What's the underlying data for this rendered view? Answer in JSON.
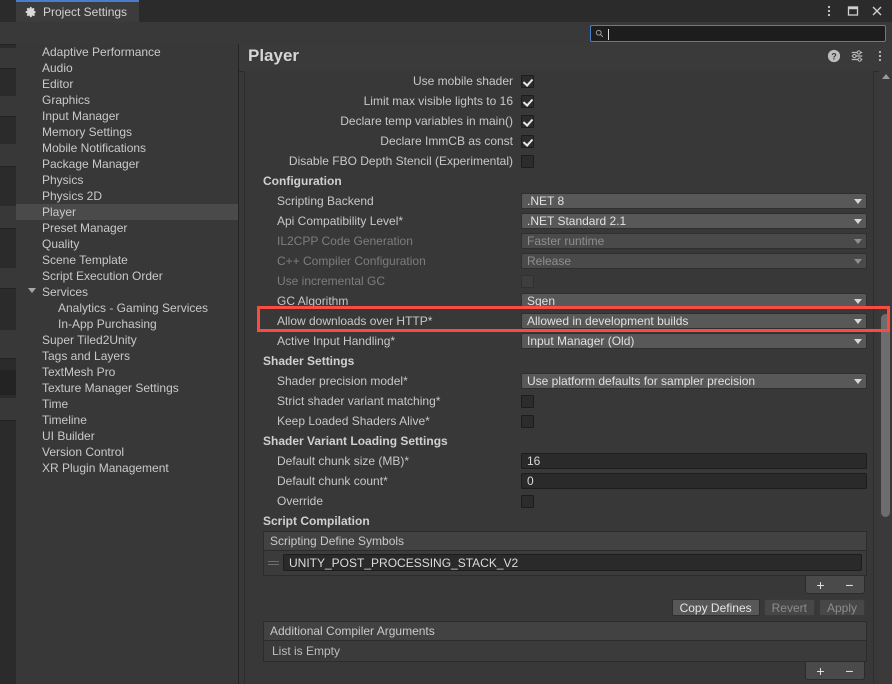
{
  "window": {
    "tab_label": "Project Settings",
    "tab_icon": "gear-icon",
    "controls": [
      {
        "name": "more-menu-icon",
        "glyph": "kebab"
      },
      {
        "name": "maximize-icon",
        "glyph": "square"
      },
      {
        "name": "close-icon",
        "glyph": "x"
      }
    ]
  },
  "search": {
    "value": "",
    "placeholder": "",
    "icon": "search-icon"
  },
  "sidebar": {
    "items": [
      {
        "label": "Adaptive Performance",
        "selected": false,
        "indent": false,
        "expandable": false
      },
      {
        "label": "Audio",
        "selected": false,
        "indent": false,
        "expandable": false
      },
      {
        "label": "Editor",
        "selected": false,
        "indent": false,
        "expandable": false
      },
      {
        "label": "Graphics",
        "selected": false,
        "indent": false,
        "expandable": false
      },
      {
        "label": "Input Manager",
        "selected": false,
        "indent": false,
        "expandable": false
      },
      {
        "label": "Memory Settings",
        "selected": false,
        "indent": false,
        "expandable": false
      },
      {
        "label": "Mobile Notifications",
        "selected": false,
        "indent": false,
        "expandable": false
      },
      {
        "label": "Package Manager",
        "selected": false,
        "indent": false,
        "expandable": false
      },
      {
        "label": "Physics",
        "selected": false,
        "indent": false,
        "expandable": false
      },
      {
        "label": "Physics 2D",
        "selected": false,
        "indent": false,
        "expandable": false
      },
      {
        "label": "Player",
        "selected": true,
        "indent": false,
        "expandable": false
      },
      {
        "label": "Preset Manager",
        "selected": false,
        "indent": false,
        "expandable": false
      },
      {
        "label": "Quality",
        "selected": false,
        "indent": false,
        "expandable": false
      },
      {
        "label": "Scene Template",
        "selected": false,
        "indent": false,
        "expandable": false
      },
      {
        "label": "Script Execution Order",
        "selected": false,
        "indent": false,
        "expandable": false
      },
      {
        "label": "Services",
        "selected": false,
        "indent": false,
        "expandable": true
      },
      {
        "label": "Analytics - Gaming Services",
        "selected": false,
        "indent": true,
        "expandable": false
      },
      {
        "label": "In-App Purchasing",
        "selected": false,
        "indent": true,
        "expandable": false
      },
      {
        "label": "Super Tiled2Unity",
        "selected": false,
        "indent": false,
        "expandable": false
      },
      {
        "label": "Tags and Layers",
        "selected": false,
        "indent": false,
        "expandable": false
      },
      {
        "label": "TextMesh Pro",
        "selected": false,
        "indent": false,
        "expandable": false
      },
      {
        "label": "Texture Manager Settings",
        "selected": false,
        "indent": false,
        "expandable": false
      },
      {
        "label": "Time",
        "selected": false,
        "indent": false,
        "expandable": false
      },
      {
        "label": "Timeline",
        "selected": false,
        "indent": false,
        "expandable": false
      },
      {
        "label": "UI Builder",
        "selected": false,
        "indent": false,
        "expandable": false
      },
      {
        "label": "Version Control",
        "selected": false,
        "indent": false,
        "expandable": false
      },
      {
        "label": "XR Plugin Management",
        "selected": false,
        "indent": false,
        "expandable": false
      }
    ]
  },
  "main": {
    "title": "Player",
    "header_icons": [
      {
        "name": "help-icon"
      },
      {
        "name": "preset-icon"
      },
      {
        "name": "context-menu-icon"
      }
    ],
    "top_checkboxes": [
      {
        "label": "Use mobile shader",
        "checked": true,
        "disabled": false
      },
      {
        "label": "Limit max visible lights to 16",
        "checked": true,
        "disabled": false
      },
      {
        "label": "Declare temp variables in main()",
        "checked": true,
        "disabled": false
      },
      {
        "label": "Declare ImmCB as const",
        "checked": true,
        "disabled": false
      },
      {
        "label": "Disable FBO Depth Stencil (Experimental)",
        "checked": false,
        "disabled": false
      }
    ],
    "configuration": {
      "heading": "Configuration",
      "rows": [
        {
          "label": "Scripting Backend",
          "type": "dropdown",
          "value": ".NET 8",
          "disabled": false,
          "highlighted": false
        },
        {
          "label": "Api Compatibility Level*",
          "type": "dropdown",
          "value": ".NET Standard 2.1",
          "disabled": false,
          "highlighted": false
        },
        {
          "label": "IL2CPP Code Generation",
          "type": "dropdown",
          "value": "Faster runtime",
          "disabled": true,
          "highlighted": false
        },
        {
          "label": "C++ Compiler Configuration",
          "type": "dropdown",
          "value": "Release",
          "disabled": true,
          "highlighted": false
        },
        {
          "label": "Use incremental GC",
          "type": "checkbox",
          "value": false,
          "disabled": true,
          "highlighted": false
        },
        {
          "label": "GC Algorithm",
          "type": "dropdown",
          "value": "Sgen",
          "disabled": false,
          "highlighted": false
        },
        {
          "label": "Allow downloads over HTTP*",
          "type": "dropdown",
          "value": "Allowed in development builds",
          "disabled": false,
          "highlighted": true
        },
        {
          "label": "Active Input Handling*",
          "type": "dropdown",
          "value": "Input Manager (Old)",
          "disabled": false,
          "highlighted": false
        }
      ]
    },
    "shader_settings": {
      "heading": "Shader Settings",
      "rows": [
        {
          "label": "Shader precision model*",
          "type": "dropdown",
          "value": "Use platform defaults for sampler precision",
          "disabled": false
        },
        {
          "label": "Strict shader variant matching*",
          "type": "checkbox",
          "value": false,
          "disabled": false
        },
        {
          "label": "Keep Loaded Shaders Alive*",
          "type": "checkbox",
          "value": false,
          "disabled": false
        }
      ]
    },
    "shader_variant_loading": {
      "heading": "Shader Variant Loading Settings",
      "rows": [
        {
          "label": "Default chunk size (MB)*",
          "type": "text",
          "value": "16",
          "disabled": false
        },
        {
          "label": "Default chunk count*",
          "type": "text",
          "value": "0",
          "disabled": false
        },
        {
          "label": "Override",
          "type": "checkbox",
          "value": false,
          "disabled": false
        }
      ]
    },
    "script_compilation": {
      "heading": "Script Compilation",
      "defines_list": {
        "header": "Scripting Define Symbols",
        "entries": [
          "UNITY_POST_PROCESSING_STACK_V2"
        ]
      },
      "add_label": "+",
      "remove_label": "−",
      "buttons": [
        {
          "label": "Copy Defines",
          "disabled": false
        },
        {
          "label": "Revert",
          "disabled": true
        },
        {
          "label": "Apply",
          "disabled": true
        }
      ],
      "compiler_args_list": {
        "header": "Additional Compiler Arguments",
        "empty_label": "List is Empty"
      }
    }
  },
  "highlight": {
    "color": "#fa4a41",
    "target": "Allow downloads over HTTP*"
  },
  "scrollbar": {
    "name": "vertical-scrollbar",
    "thumb_top_pct": 38,
    "thumb_height_pct": 34
  }
}
